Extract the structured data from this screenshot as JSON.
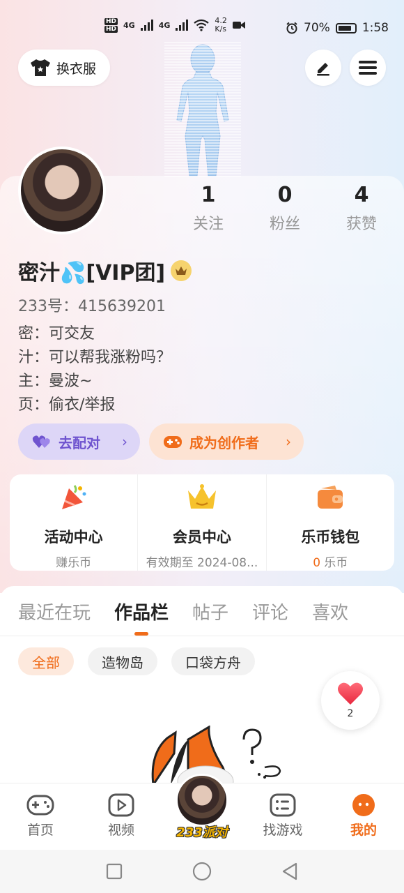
{
  "status_bar": {
    "network_speed": "4.2\nK/s",
    "network_speed_value": "4.2",
    "network_speed_unit": "K/s",
    "signal_1": "4G",
    "signal_2": "4G",
    "battery": "70%",
    "time": "1:58"
  },
  "header": {
    "outfit_label": "换衣服"
  },
  "profile": {
    "stats": [
      {
        "num": "1",
        "label": "关注"
      },
      {
        "num": "0",
        "label": "粉丝"
      },
      {
        "num": "4",
        "label": "获赞"
      }
    ],
    "name": "密汁💦[VIP团]",
    "uid": "233号：415639201",
    "bio_lines": [
      "密：可交友",
      "汁：可以帮我涨粉吗？",
      "主：曼波~",
      "页：偷衣/举报"
    ]
  },
  "actions": {
    "match_label": "去配对",
    "creator_label": "成为创作者"
  },
  "centers": [
    {
      "title": "活动中心",
      "sub": "赚乐币"
    },
    {
      "title": "会员中心",
      "sub": "有效期至 2024-08..."
    },
    {
      "title": "乐币钱包",
      "sub_num": "0",
      "sub_text": " 乐币"
    }
  ],
  "tabs": [
    "最近在玩",
    "作品栏",
    "帖子",
    "评论",
    "喜欢"
  ],
  "filters": [
    "全部",
    "造物岛",
    "口袋方舟"
  ],
  "likes_fab": {
    "count": "2"
  },
  "bottom_nav": {
    "home": "首页",
    "video": "视频",
    "center_badge": "233派对",
    "find_game": "找游戏",
    "mine": "我的"
  },
  "colors": {
    "accent": "#f06c1a",
    "purple": "#6f54cf"
  }
}
